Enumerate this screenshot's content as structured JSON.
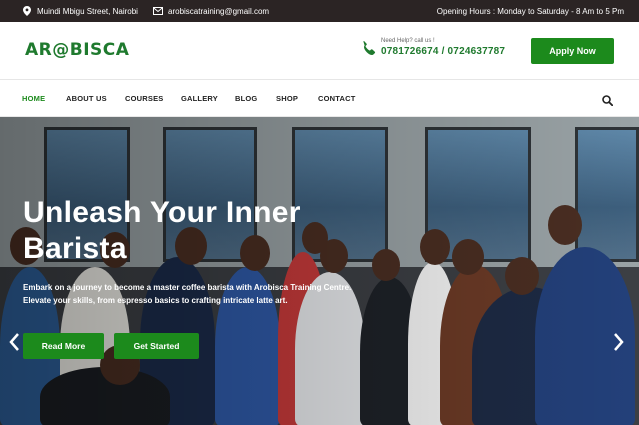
{
  "topbar": {
    "location": "Muindi Mbigu Street, Nairobi",
    "email": "arobiscatraining@gmail.com",
    "hours": "Opening Hours : Monday to Saturday - 8 Am to 5 Pm"
  },
  "header": {
    "logo": "AR@BISCA",
    "help_label": "Need Help? call us !",
    "phones": "0781726674 / 0724637787",
    "apply_label": "Apply Now"
  },
  "nav": {
    "items": [
      "HOME",
      "ABOUT US",
      "COURSES",
      "GALLERY",
      "BLOG",
      "SHOP",
      "CONTACT"
    ],
    "active": "HOME"
  },
  "hero": {
    "title": "Unleash Your Inner Barista",
    "text": "Embark on a journey to become a master coffee barista with Arobisca Training Centre. Elevate your skills, from espresso basics to crafting intricate latte art.",
    "read_more": "Read More",
    "get_started": "Get Started"
  },
  "colors": {
    "brand_green": "#1c8a1c",
    "topbar_bg": "#2b2424"
  },
  "icons": {
    "location": "location-pin-icon",
    "email": "envelope-icon",
    "phone": "phone-icon",
    "search": "search-icon",
    "prev": "chevron-left-icon",
    "next": "chevron-right-icon"
  }
}
